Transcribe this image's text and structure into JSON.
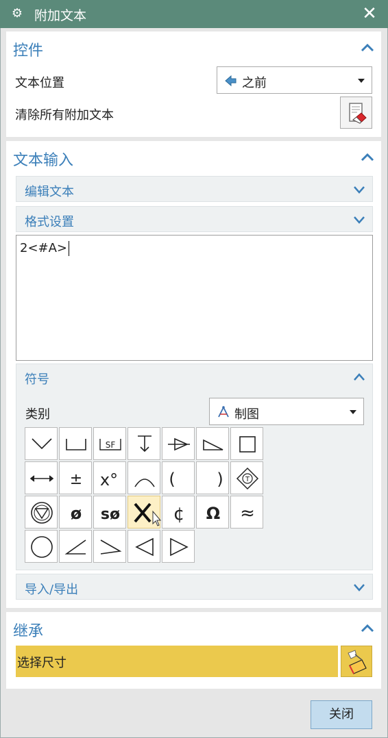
{
  "window": {
    "title": "附加文本",
    "close_glyph": "✕",
    "gear_glyph": "⚙"
  },
  "controls": {
    "heading": "控件",
    "text_position_label": "文本位置",
    "text_position_value": "之前",
    "clear_label": "清除所有附加文本"
  },
  "text_input": {
    "heading": "文本输入",
    "edit_text": "编辑文本",
    "format_settings": "格式设置",
    "content": "2<#A>"
  },
  "symbols": {
    "heading": "符号",
    "category_label": "类别",
    "category_value": "制图",
    "grid": [
      [
        "v-notch",
        "u-notch",
        "SF",
        "depth",
        "arrow-tri",
        "slope",
        "square"
      ],
      [
        "double-arrow",
        "±",
        "x°",
        "arc",
        "(",
        ")",
        "diamond-T"
      ],
      [
        "triangle-circle",
        "ø",
        "sø",
        "X",
        "¢",
        "Ω",
        "≈"
      ],
      [
        "circle",
        "angle",
        "angle2",
        "tri-left",
        "tri-right"
      ]
    ],
    "selected": "X"
  },
  "import_export": {
    "heading": "导入/导出"
  },
  "inherit": {
    "heading": "继承",
    "select_dim": "选择尺寸"
  },
  "footer": {
    "close_label": "关闭"
  },
  "colors": {
    "titlebar": "#5b8a7a",
    "accent": "#3b7fb9",
    "highlight": "#ebc94d"
  }
}
